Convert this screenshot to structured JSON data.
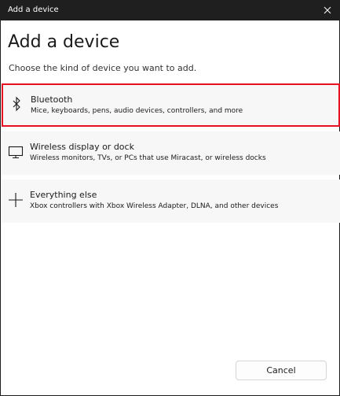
{
  "window": {
    "title": "Add a device"
  },
  "main": {
    "heading": "Add a device",
    "subheading": "Choose the kind of device you want to add.",
    "options": [
      {
        "label": "Bluetooth",
        "description": "Mice, keyboards, pens, audio devices, controllers, and more",
        "icon": "bluetooth-icon",
        "selected": true
      },
      {
        "label": "Wireless display or dock",
        "description": "Wireless monitors, TVs, or PCs that use Miracast, or wireless docks",
        "icon": "monitor-icon",
        "selected": false
      },
      {
        "label": "Everything else",
        "description": "Xbox controllers with Xbox Wireless Adapter, DLNA, and other devices",
        "icon": "plus-icon",
        "selected": false
      }
    ]
  },
  "footer": {
    "cancel_label": "Cancel"
  },
  "colors": {
    "titlebar": "#1f1f1f",
    "selection_border": "#e81123",
    "option_background": "#f7f7f7"
  }
}
